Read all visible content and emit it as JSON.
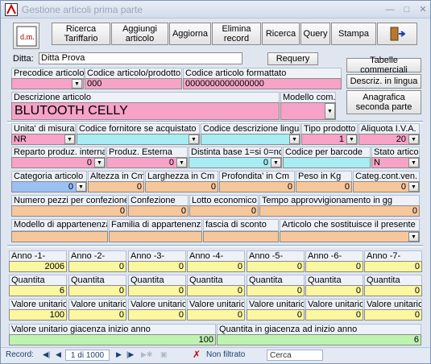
{
  "window": {
    "title": "Gestione articoli prima parte"
  },
  "toolbar": {
    "ricerca_tariffario": "Ricerca Tariffario",
    "aggiungi": "Aggiungi articolo",
    "aggiorna": "Aggiorna",
    "elimina": "Elimina record",
    "ricerca": "Ricerca",
    "query": "Query",
    "stampa": "Stampa"
  },
  "header": {
    "ditta_label": "Ditta:",
    "ditta_value": "Ditta Prova",
    "requery": "Requery",
    "tabelle": "Tabelle commerciali",
    "descriz_lingua": "Descriz. in lingua",
    "anagrafica": "Anagrafica seconda parte"
  },
  "row1": {
    "precodice_label": "Precodice articolo",
    "codice_label": "Codice articolo/prodotto",
    "codice_value": "000",
    "formattato_label": "Codice articolo formattato",
    "formattato_value": "0000000000000000"
  },
  "row2": {
    "descrizione_label": "Descrizione articolo",
    "descrizione_value": "BLUTOOTH CELLY",
    "modello_label": "Modello com."
  },
  "row3": {
    "unita_label": "Unita' di misura",
    "unita_value": "NR",
    "fornitore_label": "Codice fornitore se acquistato",
    "lingua_label": "Codice descrizione lingua",
    "tipo_label": "Tipo prodotto",
    "tipo_value": "1",
    "aliquota_label": "Aliquota I.V.A.",
    "aliquota_value": "20"
  },
  "row4": {
    "reparto_label": "Reparto produz. interna",
    "reparto_value": "0",
    "esterna_label": "Produz. Esterna",
    "esterna_value": "0",
    "distinta_label": "Distinta base 1=si 0=no",
    "distinta_value": "0",
    "barcode_label": "Codice per barcode",
    "stato_label": "Stato articolo",
    "stato_value": "N"
  },
  "row5": {
    "categoria_label": "Categoria articolo",
    "categoria_value": "0",
    "altezza_label": "Altezza in Cm",
    "altezza_value": "0",
    "larghezza_label": "Larghezza in Cm",
    "larghezza_value": "0",
    "profondita_label": "Profondita' in Cm",
    "profondita_value": "0",
    "peso_label": "Peso in Kg",
    "peso_value": "0",
    "categcont_label": "Categ.cont.ven.",
    "categcont_value": "0"
  },
  "row6": {
    "numero_label": "Numero pezzi per confezione",
    "numero_value": "0",
    "confezione_label": "Confezione",
    "confezione_value": "0",
    "lotto_label": "Lotto economico",
    "lotto_value": "0",
    "tempo_label": "Tempo approvvigionamento in gg",
    "tempo_value": "0"
  },
  "row7": {
    "modello_app_label": "Modello di appartenenza",
    "famiglia_label": "Familia di appartenenza",
    "fascia_label": "fascia di sconto",
    "sostituisce_label": "Articolo che sostituisce il presente"
  },
  "years": {
    "anno_labels": [
      "Anno -1-",
      "Anno -2-",
      "Anno -3-",
      "Anno -4-",
      "Anno -5-",
      "Anno -6-",
      "Anno -7-"
    ],
    "anno_values": [
      "2006",
      "0",
      "0",
      "0",
      "0",
      "0",
      "0"
    ],
    "quantita_label": "Quantita",
    "quantita_values": [
      "6",
      "0",
      "0",
      "0",
      "0",
      "0",
      "0"
    ],
    "valore_label": "Valore unitario",
    "valore_values": [
      "100",
      "0",
      "0",
      "0",
      "0",
      "0",
      "0"
    ]
  },
  "giacenza": {
    "valore_label": "Valore unitario giacenza inizio anno",
    "valore_value": "100",
    "quantita_label": "Quantita in giacenza ad inizio anno",
    "quantita_value": "6"
  },
  "status": {
    "record_label": "Record:",
    "record_value": "1 di 1000",
    "filter": "Non filtrato",
    "search": "Cerca"
  },
  "colors": {
    "pink": "#f6a3c7",
    "cyan": "#a8ecf4",
    "orange": "#f7c79c",
    "yellow": "#fbf6a0",
    "green": "#bef3b0",
    "blue": "#9cc0f3"
  }
}
